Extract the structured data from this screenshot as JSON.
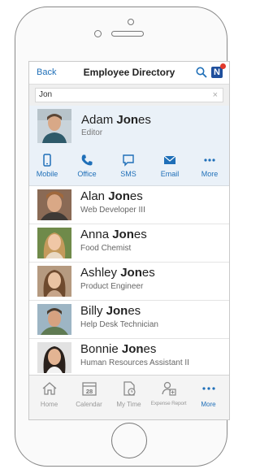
{
  "nav": {
    "back_label": "Back",
    "title": "Employee Directory",
    "logo_letter": "N"
  },
  "search": {
    "value": "Jon",
    "clear_icon": "×"
  },
  "selected_contact": {
    "name_pre": "Adam ",
    "name_hl": "Jon",
    "name_post": "es",
    "title": "Editor",
    "actions": [
      {
        "label": "Mobile",
        "icon": "mobile-icon"
      },
      {
        "label": "Office",
        "icon": "phone-icon"
      },
      {
        "label": "SMS",
        "icon": "sms-icon"
      },
      {
        "label": "Email",
        "icon": "email-icon"
      },
      {
        "label": "More",
        "icon": "more-icon"
      }
    ]
  },
  "contacts": [
    {
      "name_pre": "Alan ",
      "name_hl": "Jon",
      "name_post": "es",
      "title": "Web Developer III"
    },
    {
      "name_pre": "Anna ",
      "name_hl": "Jon",
      "name_post": "es",
      "title": "Food Chemist"
    },
    {
      "name_pre": "Ashley ",
      "name_hl": "Jon",
      "name_post": "es",
      "title": "Product Engineer"
    },
    {
      "name_pre": "Billy ",
      "name_hl": "Jon",
      "name_post": "es",
      "title": "Help Desk Technician"
    },
    {
      "name_pre": "Bonnie ",
      "name_hl": "Jon",
      "name_post": "es",
      "title": "Human Resources Assistant II"
    }
  ],
  "tabs": [
    {
      "label": "Home",
      "icon": "home-icon"
    },
    {
      "label": "Calendar",
      "icon": "calendar-icon",
      "day": "28"
    },
    {
      "label": "My Time",
      "icon": "clock-icon"
    },
    {
      "label": "Expense Report",
      "icon": "expense-icon"
    },
    {
      "label": "More",
      "icon": "more-icon"
    }
  ],
  "colors": {
    "accent": "#1f6fb8",
    "selected_bg": "#eaf1f8",
    "badge": "#e23a2c"
  }
}
